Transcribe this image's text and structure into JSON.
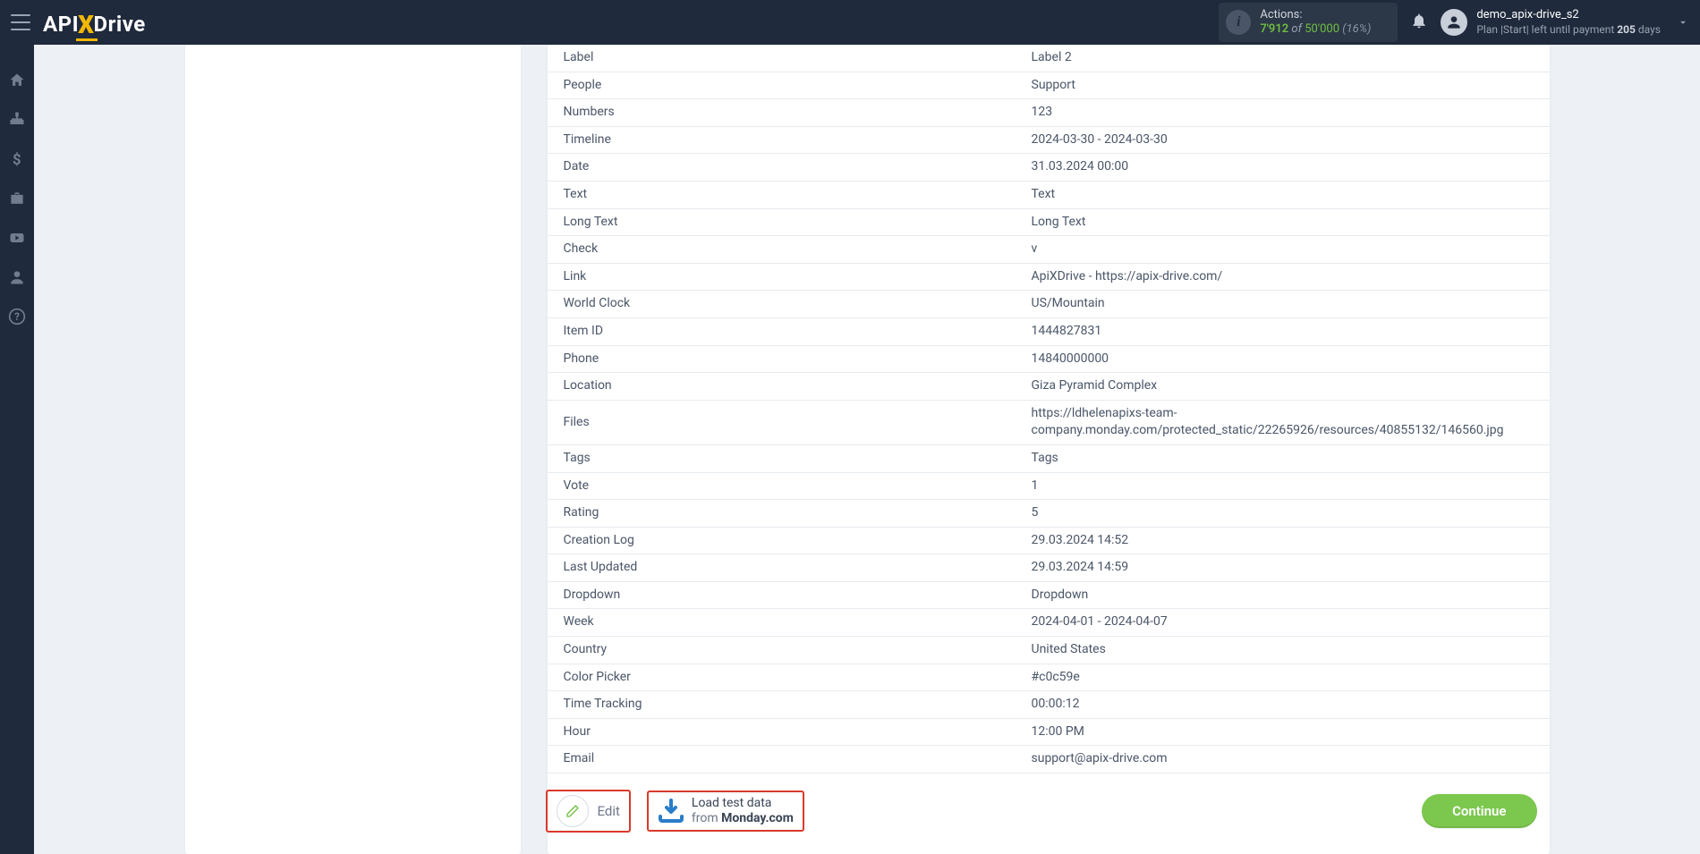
{
  "header": {
    "logo_api": "API",
    "logo_x": "X",
    "logo_drive": "Drive",
    "actions_label": "Actions:",
    "actions_used": "7'912",
    "actions_of": "of",
    "actions_total": "50'000",
    "actions_pct": "(16%)",
    "username": "demo_apix-drive_s2",
    "plan_prefix": "Plan |Start| left until payment ",
    "plan_days": "205",
    "plan_suffix": " days"
  },
  "rows": [
    {
      "k": "Label",
      "v": "Label 2"
    },
    {
      "k": "People",
      "v": "Support"
    },
    {
      "k": "Numbers",
      "v": "123"
    },
    {
      "k": "Timeline",
      "v": "2024-03-30 - 2024-03-30"
    },
    {
      "k": "Date",
      "v": "31.03.2024 00:00"
    },
    {
      "k": "Text",
      "v": "Text"
    },
    {
      "k": "Long Text",
      "v": "Long Text"
    },
    {
      "k": "Check",
      "v": "v"
    },
    {
      "k": "Link",
      "v": "ApiXDrive - https://apix-drive.com/"
    },
    {
      "k": "World Clock",
      "v": "US/Mountain"
    },
    {
      "k": "Item ID",
      "v": "1444827831"
    },
    {
      "k": "Phone",
      "v": "14840000000"
    },
    {
      "k": "Location",
      "v": "Giza Pyramid Complex"
    },
    {
      "k": "Files",
      "v": "https://ldhelenapixs-team-company.monday.com/protected_static/22265926/resources/40855132/146560.jpg"
    },
    {
      "k": "Tags",
      "v": "Tags"
    },
    {
      "k": "Vote",
      "v": "1"
    },
    {
      "k": "Rating",
      "v": "5"
    },
    {
      "k": "Creation Log",
      "v": "29.03.2024 14:52"
    },
    {
      "k": "Last Updated",
      "v": "29.03.2024 14:59"
    },
    {
      "k": "Dropdown",
      "v": "Dropdown"
    },
    {
      "k": "Week",
      "v": "2024-04-01 - 2024-04-07"
    },
    {
      "k": "Country",
      "v": "United States"
    },
    {
      "k": "Color Picker",
      "v": "#c0c59e"
    },
    {
      "k": "Time Tracking",
      "v": "00:00:12"
    },
    {
      "k": "Hour",
      "v": "12:00 PM"
    },
    {
      "k": "Email",
      "v": "support@apix-drive.com"
    }
  ],
  "buttons": {
    "edit": "Edit",
    "load_line1": "Load test data",
    "load_line2_prefix": "from ",
    "load_line2_bold": "Monday.com",
    "continue": "Continue"
  }
}
